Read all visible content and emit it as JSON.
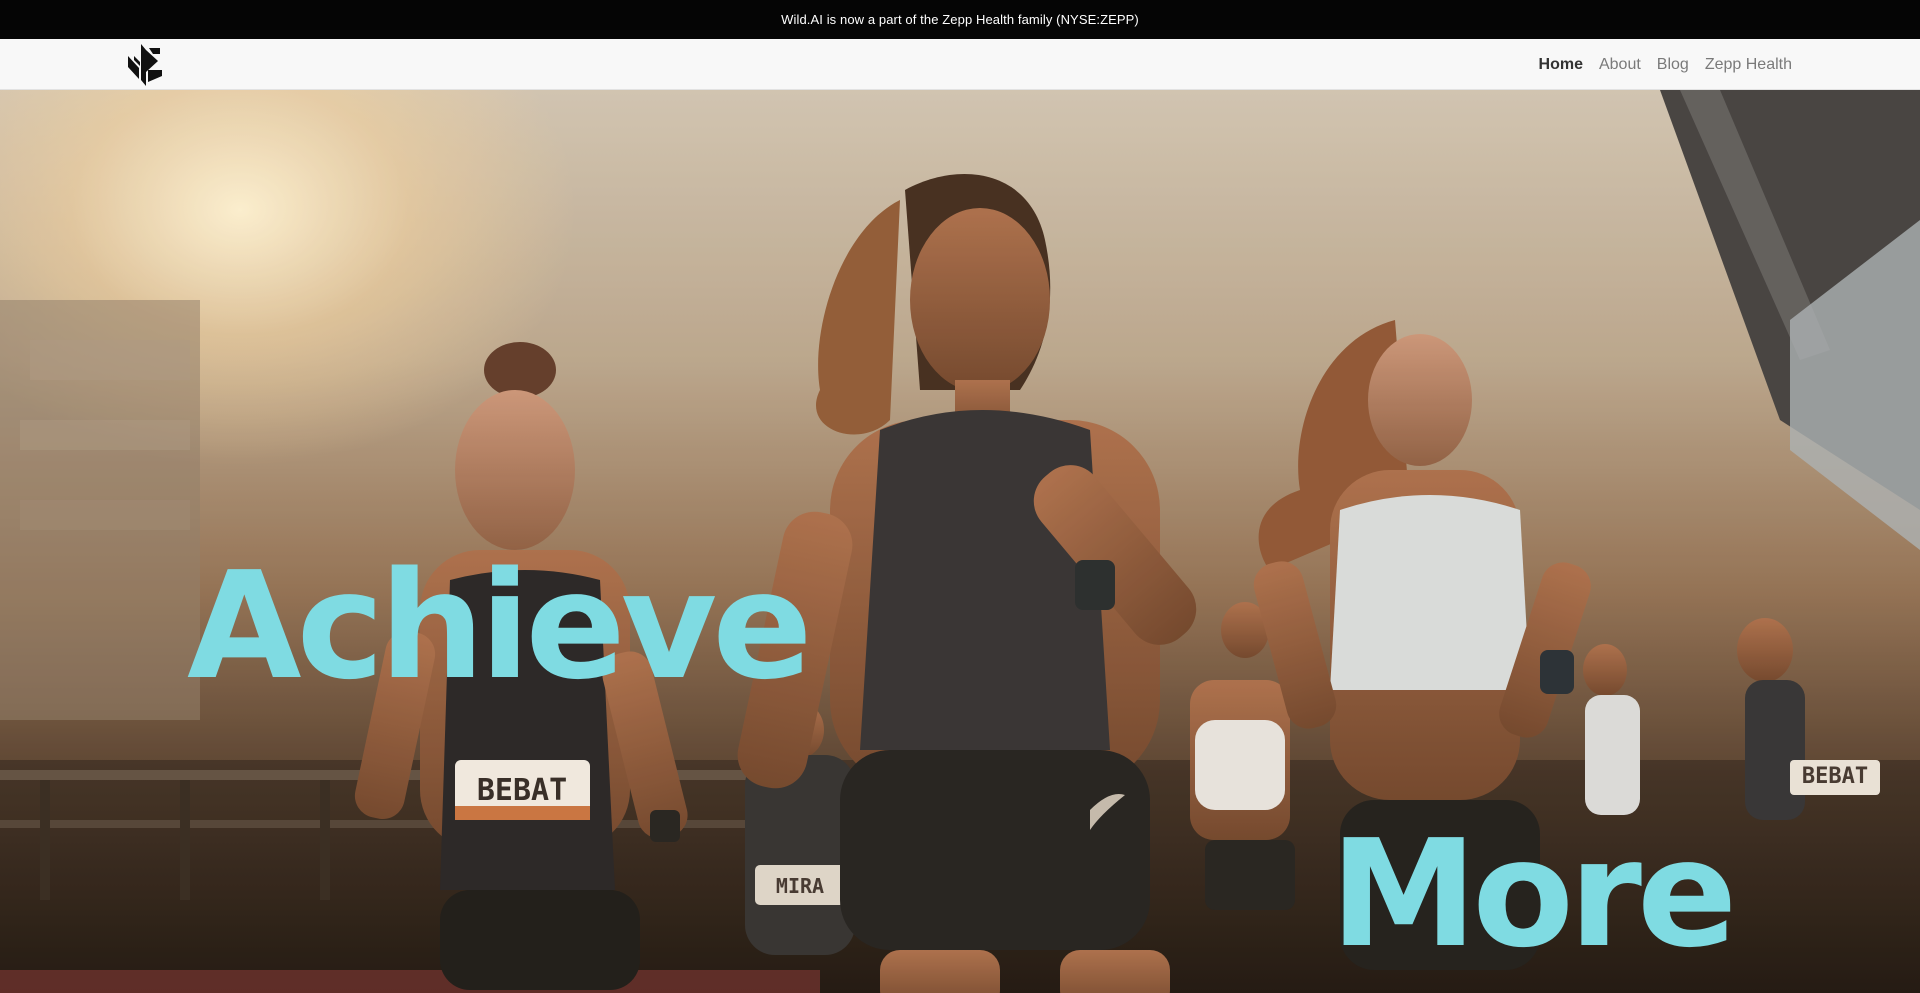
{
  "announcement": {
    "text": "Wild.AI is now a part of the Zepp Health family (NYSE:ZEPP)"
  },
  "nav": {
    "logo_icon": "wild-ai-logo-icon",
    "links": [
      {
        "label": "Home",
        "active": true
      },
      {
        "label": "About",
        "active": false
      },
      {
        "label": "Blog",
        "active": false
      },
      {
        "label": "Zepp Health",
        "active": false
      }
    ]
  },
  "hero": {
    "word1": "Achieve",
    "word2": "More",
    "bib_left": "BEBAT",
    "bib_right": "BEBAT",
    "bib_center": "MIRA",
    "accent_color": "#7fdbe2"
  }
}
